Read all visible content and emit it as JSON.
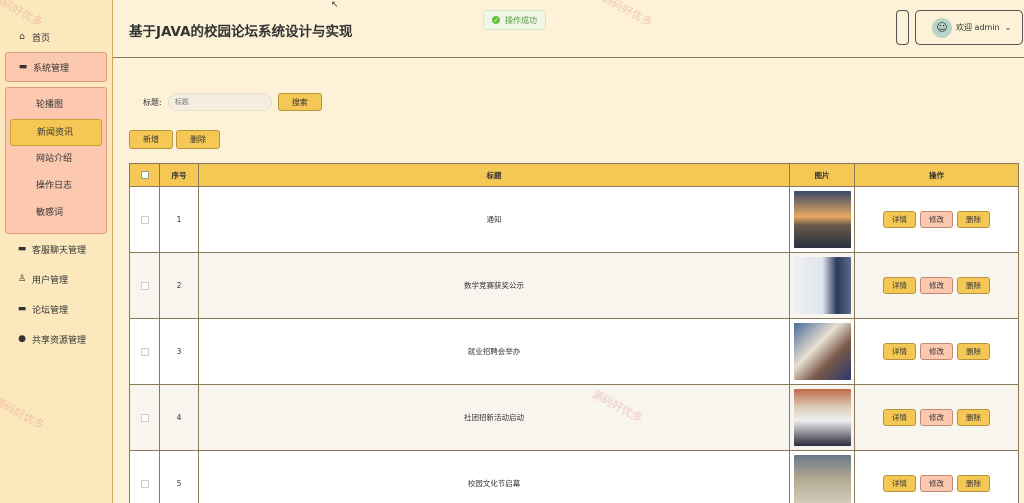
{
  "sidebar": {
    "items": [
      {
        "label": "首页",
        "icon": "⌂"
      },
      {
        "label": "系统管理",
        "icon": "▬"
      },
      {
        "label": "客服聊天管理",
        "icon": "▬"
      },
      {
        "label": "用户管理",
        "icon": "♙"
      },
      {
        "label": "论坛管理",
        "icon": "▬"
      },
      {
        "label": "共享资源管理",
        "icon": "●"
      }
    ],
    "submenu": [
      "轮播图",
      "新闻资讯",
      "网站介绍",
      "操作日志",
      "敏感词"
    ]
  },
  "header": {
    "title": "基于JAVA的校园论坛系统设计与实现",
    "toast": "操作成功",
    "welcome": "欢迎 admin"
  },
  "search": {
    "label": "标题:",
    "placeholder": "标题",
    "button": "搜索"
  },
  "actions": {
    "add": "新增",
    "delete": "删除"
  },
  "table": {
    "columns": [
      "序号",
      "标题",
      "图片",
      "操作"
    ],
    "rows": [
      {
        "no": "1",
        "title": "通知"
      },
      {
        "no": "2",
        "title": "数学竞赛获奖公示"
      },
      {
        "no": "3",
        "title": "就业招聘会举办"
      },
      {
        "no": "4",
        "title": "社团招新活动启动"
      },
      {
        "no": "5",
        "title": "校园文化节启幕"
      }
    ],
    "ops": {
      "detail": "详情",
      "edit": "修改",
      "delete": "删除"
    }
  },
  "watermark": "源码好优多",
  "colors": {
    "primary": "#f5c855",
    "accent": "#fcc9b0",
    "background": "#fdf2d8"
  }
}
